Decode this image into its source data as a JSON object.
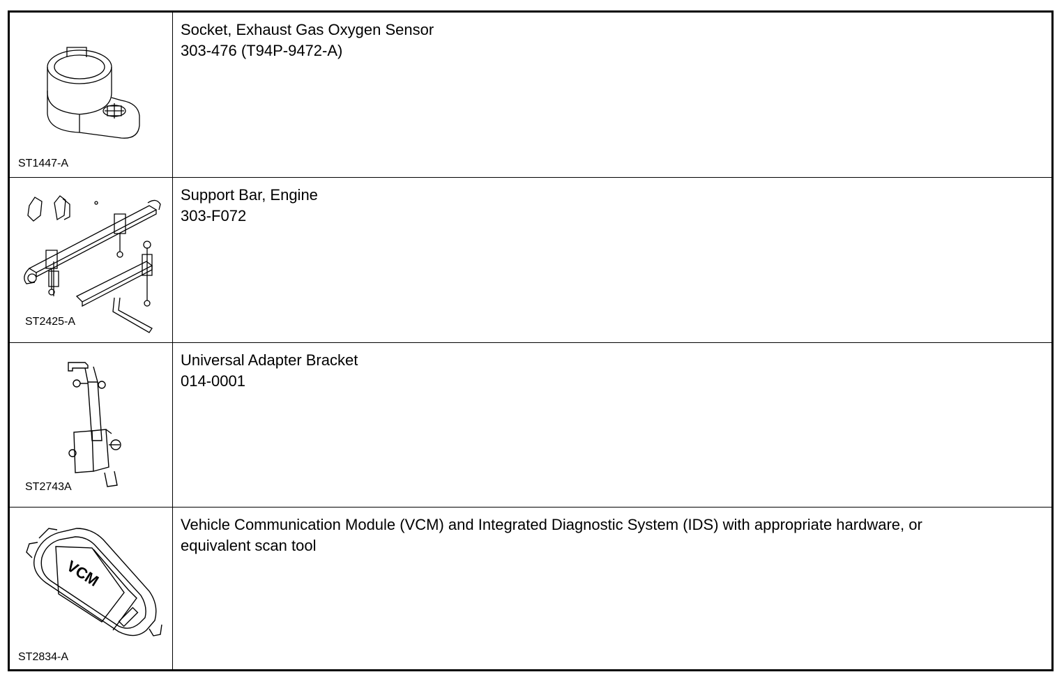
{
  "tools": [
    {
      "illustration_code": "ST1447-A",
      "name": "Socket, Exhaust Gas Oxygen Sensor",
      "number": "303-476 (T94P-9472-A)",
      "icon": "oxygen-sensor-socket-icon"
    },
    {
      "illustration_code": "ST2425-A",
      "name": "Support Bar, Engine",
      "number": "303-F072",
      "icon": "engine-support-bar-icon"
    },
    {
      "illustration_code": "ST2743A",
      "name": "Universal Adapter Bracket",
      "number": "014-0001",
      "icon": "adapter-bracket-icon"
    },
    {
      "illustration_code": "ST2834-A",
      "name": "Vehicle Communication Module (VCM) and Integrated Diagnostic System (IDS) with appropriate hardware, or",
      "number": "equivalent scan tool",
      "icon": "vcm-module-icon",
      "badge": "VCM"
    }
  ]
}
